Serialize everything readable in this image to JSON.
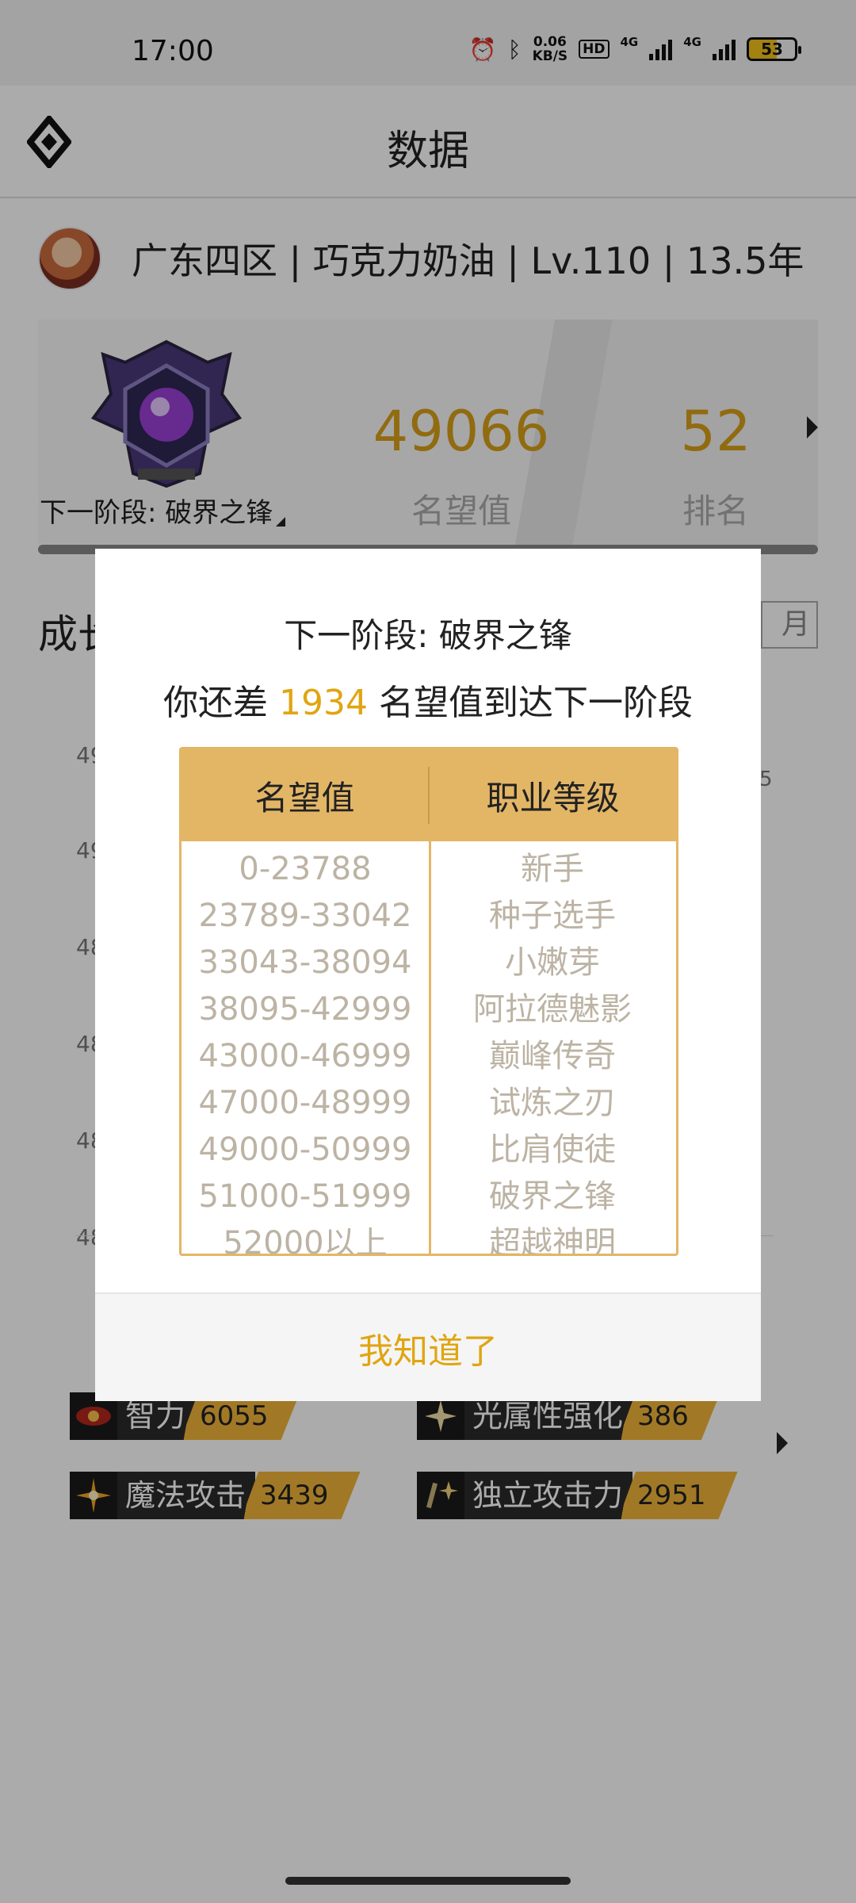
{
  "status_bar": {
    "time": "17:00",
    "net_speed_value": "0.06",
    "net_speed_unit": "KB/S",
    "hd_label": "HD",
    "network_1": "4G",
    "network_2": "4G",
    "battery": "53"
  },
  "app_bar": {
    "title": "数据"
  },
  "profile": {
    "summary": "广东四区 | 巧克力奶油 | Lv.110 | 13.5年"
  },
  "rank_card": {
    "next_stage": "下一阶段: 破界之锋",
    "reputation_value": "49066",
    "reputation_label": "名望值",
    "rank_value": "52",
    "rank_label": "排名"
  },
  "growth": {
    "title_partial": "成长",
    "month_button": "月",
    "y_ticks": [
      "49",
      "49",
      "48",
      "48",
      "48",
      "48"
    ],
    "edge_mark": "5"
  },
  "stats": [
    {
      "icon": "eye-icon",
      "label": "智力",
      "value": "6055"
    },
    {
      "icon": "light-sword-icon",
      "label": "光属性强化",
      "value": "386"
    },
    {
      "icon": "magic-burst-icon",
      "label": "魔法攻击",
      "value": "3439"
    },
    {
      "icon": "sword-sparkle-icon",
      "label": "独立攻击力",
      "value": "2951"
    }
  ],
  "dialog": {
    "title": "下一阶段: 破界之锋",
    "message_prefix": "你还差 ",
    "message_amount": "1934",
    "message_suffix": " 名望值到达下一阶段",
    "table": {
      "headers": [
        "名望值",
        "职业等级"
      ],
      "rows": [
        [
          "0-23788",
          "新手"
        ],
        [
          "23789-33042",
          "种子选手"
        ],
        [
          "33043-38094",
          "小嫩芽"
        ],
        [
          "38095-42999",
          "阿拉德魅影"
        ],
        [
          "43000-46999",
          "巅峰传奇"
        ],
        [
          "47000-48999",
          "试炼之刃"
        ],
        [
          "49000-50999",
          "比肩使徒"
        ],
        [
          "51000-51999",
          "破界之锋"
        ],
        [
          "52000以上",
          "超越神明"
        ]
      ]
    },
    "ok_label": "我知道了"
  },
  "colors": {
    "accent": "#e0a511",
    "table_header": "#e3b666",
    "table_text": "#bcb3a4",
    "scrim": "rgba(0,0,0,0.33)"
  }
}
